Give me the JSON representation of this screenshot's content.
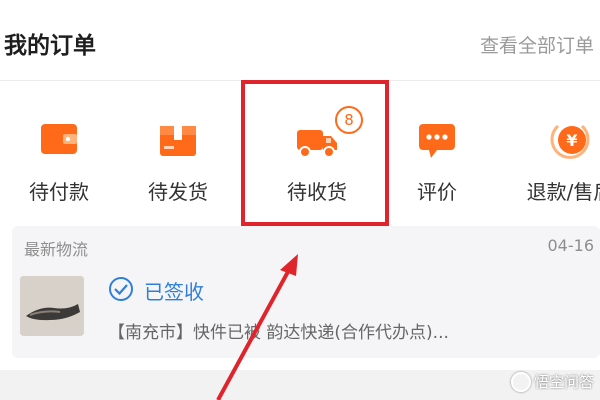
{
  "header": {
    "title": "我的订单",
    "view_all": "查看全部订单"
  },
  "order_statuses": [
    {
      "label": "待付款",
      "icon": "wallet-icon"
    },
    {
      "label": "待发货",
      "icon": "package-box-icon"
    },
    {
      "label": "待收货",
      "icon": "delivery-truck-icon",
      "badge": "8"
    },
    {
      "label": "评价",
      "icon": "comment-bubble-icon"
    },
    {
      "label": "退款/售后",
      "icon": "refund-yen-icon"
    }
  ],
  "logistics": {
    "title": "最新物流",
    "date": "04-16",
    "status": "已签收",
    "detail": "【南充市】快件已被 韵达快递(合作代办点)..."
  },
  "watermark": "悟空问答",
  "colors": {
    "accent_orange": "#ff6a1a",
    "highlight_red": "#e0242b",
    "signed_blue": "#2f7fd8"
  }
}
